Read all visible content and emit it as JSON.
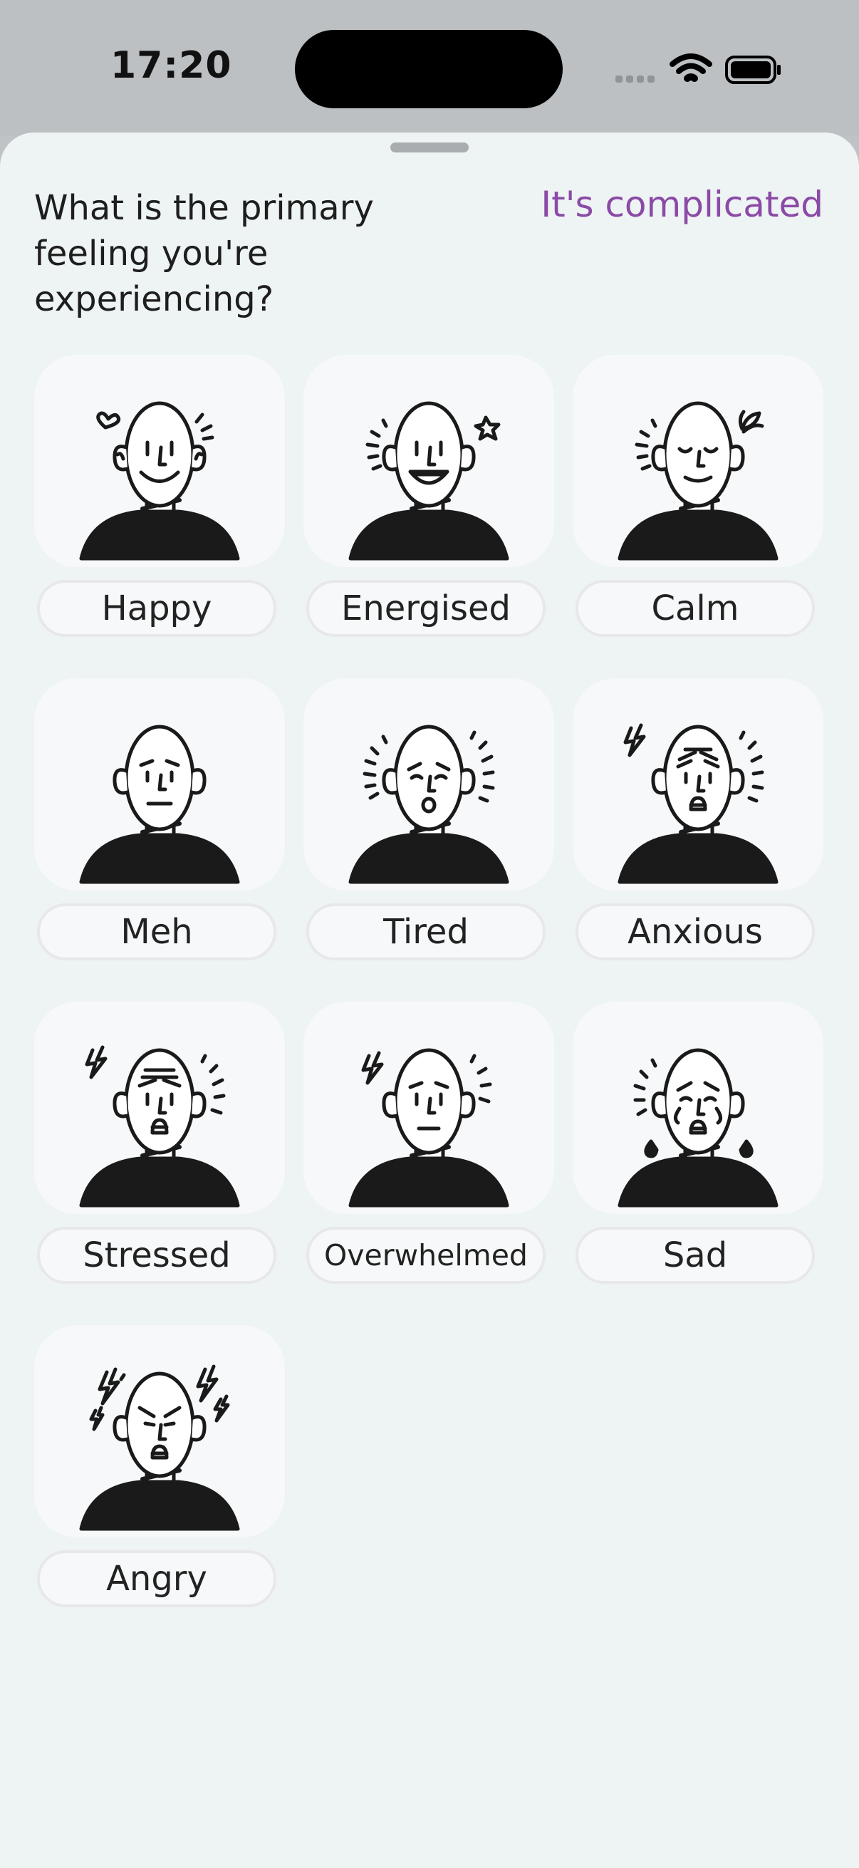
{
  "status_bar": {
    "time": "17:20",
    "icons": [
      "cellular-signal-icon",
      "wifi-icon",
      "battery-icon"
    ]
  },
  "sheet": {
    "question": "What is the primary feeling you're experiencing?",
    "complicated_label": "It's complicated",
    "accent_color": "#8a4aa6"
  },
  "moods": [
    {
      "label": "Happy",
      "icon": "happy-face-icon"
    },
    {
      "label": "Energised",
      "icon": "energised-face-icon"
    },
    {
      "label": "Calm",
      "icon": "calm-face-icon"
    },
    {
      "label": "Meh",
      "icon": "meh-face-icon"
    },
    {
      "label": "Tired",
      "icon": "tired-face-icon"
    },
    {
      "label": "Anxious",
      "icon": "anxious-face-icon"
    },
    {
      "label": "Stressed",
      "icon": "stressed-face-icon"
    },
    {
      "label": "Overwhelmed",
      "icon": "overwhelmed-face-icon"
    },
    {
      "label": "Sad",
      "icon": "sad-face-icon"
    },
    {
      "label": "Angry",
      "icon": "angry-face-icon"
    }
  ]
}
